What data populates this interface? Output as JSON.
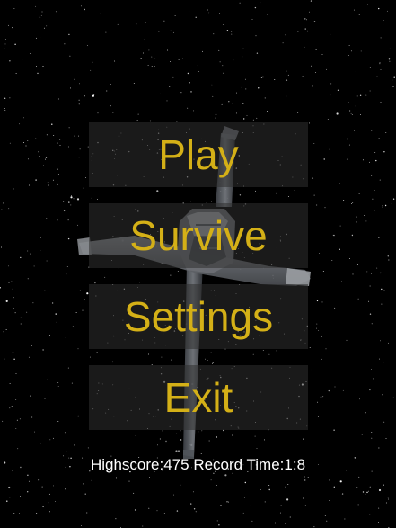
{
  "menu": {
    "play_label": "Play",
    "survive_label": "Survive",
    "settings_label": "Settings",
    "exit_label": "Exit"
  },
  "stats": {
    "highscore_label": "Highscore:",
    "highscore_value": "475",
    "record_time_label": "Record Time:",
    "record_time_value": "1:8"
  },
  "colors": {
    "background": "#000000",
    "button_text": "#d4b017",
    "button_fill": "#303030",
    "stats_text": "#ffffff"
  },
  "icons": {
    "background": "starfield",
    "centerpiece": "b-wing-starfighter"
  }
}
